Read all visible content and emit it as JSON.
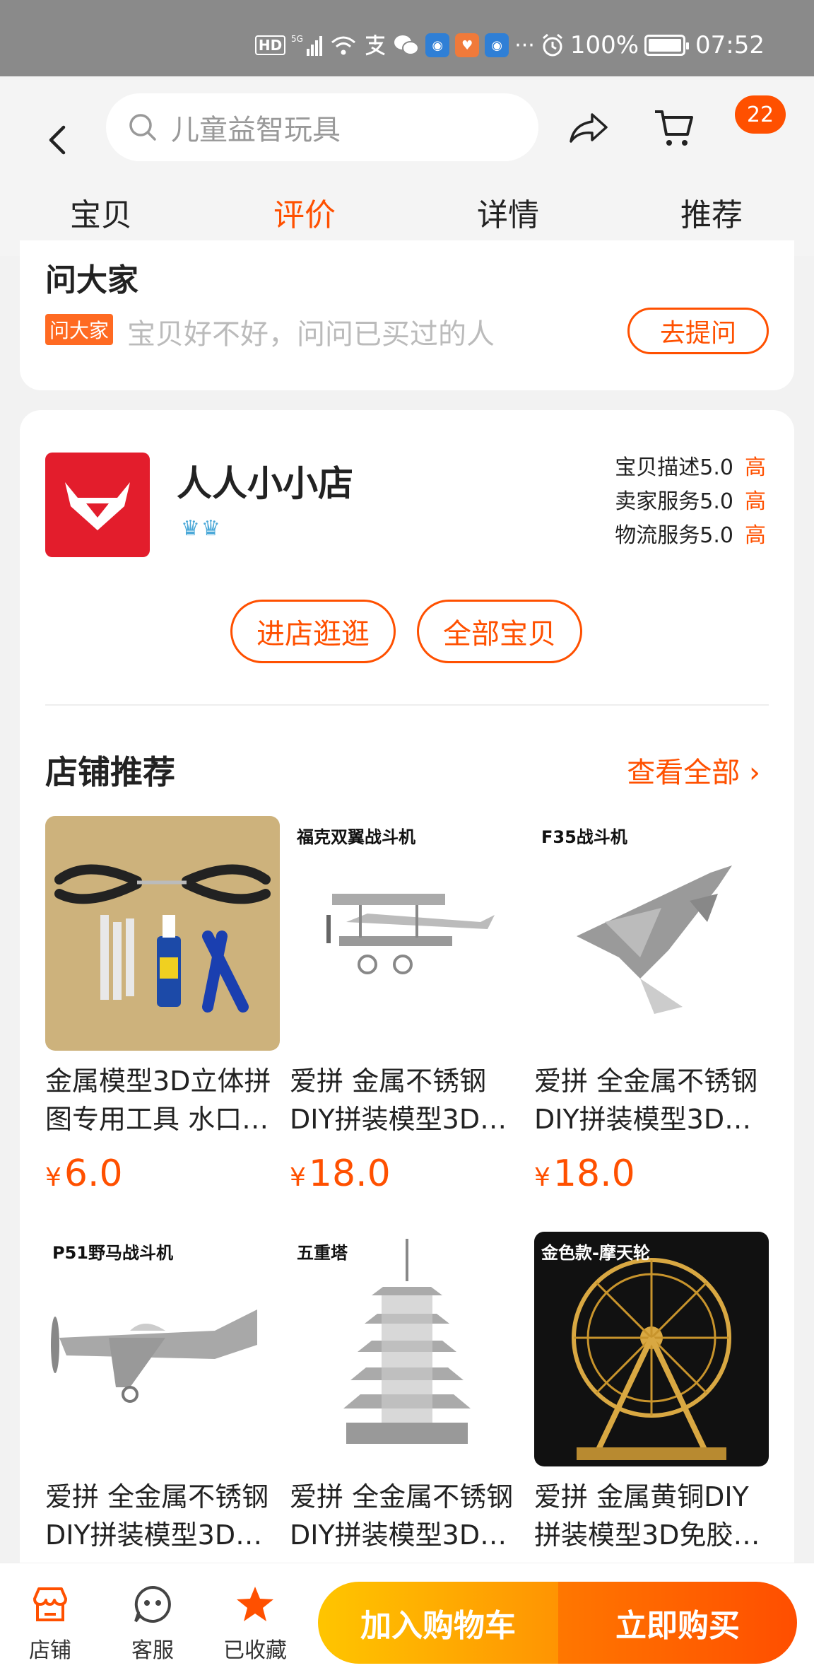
{
  "status_bar": {
    "hd": "HD",
    "net": "5G",
    "battery": "100%",
    "time": "07:52"
  },
  "header": {
    "search_placeholder": "儿童益智玩具",
    "cart_count": "22",
    "tabs": [
      "宝贝",
      "评价",
      "详情",
      "推荐"
    ],
    "active_tab": "评价"
  },
  "ask": {
    "title": "问大家",
    "tag": "问大家",
    "hint": "宝贝好不好，问问已买过的人",
    "button": "去提问"
  },
  "shop": {
    "name": "人人小小店",
    "ratings": [
      {
        "label": "宝贝描述5.0",
        "level": "高"
      },
      {
        "label": "卖家服务5.0",
        "level": "高"
      },
      {
        "label": "物流服务5.0",
        "level": "高"
      }
    ],
    "visit_button": "进店逛逛",
    "all_button": "全部宝贝",
    "rec_title": "店铺推荐",
    "rec_more": "查看全部"
  },
  "products": [
    {
      "caption": "",
      "title": "金属模型3D立体拼图专用工具 水口…",
      "line1": "金属模型3D立体拼",
      "line2": "图专用工具 水口…",
      "price": "6.0"
    },
    {
      "caption": "福克双翼战斗机",
      "line1": "爱拼 金属不锈钢",
      "line2": "DIY拼装模型3D…",
      "price": "18.0"
    },
    {
      "caption": "F35战斗机",
      "line1": "爱拼 全金属不锈钢",
      "line2": "DIY拼装模型3D…",
      "price": "18.0"
    },
    {
      "caption": "P51野马战斗机",
      "line1": "爱拼 全金属不锈钢",
      "line2": "DIY拼装模型3D…"
    },
    {
      "caption": "五重塔",
      "line1": "爱拼 全金属不锈钢",
      "line2": "DIY拼装模型3D…"
    },
    {
      "caption": "金色款-摩天轮",
      "line1": "爱拼 金属黄铜DIY",
      "line2": "拼装模型3D免胶…"
    }
  ],
  "bottom_bar": {
    "shop": "店铺",
    "service": "客服",
    "favorited": "已收藏",
    "add_cart": "加入购物车",
    "buy_now": "立即购买"
  },
  "colors": {
    "accent": "#ff5000",
    "add_cart_gradient": [
      "#ffc500",
      "#ff9402"
    ],
    "buy_gradient": [
      "#ff7700",
      "#ff4e00"
    ],
    "shop_logo": "#e31d2c"
  },
  "currency": "¥"
}
